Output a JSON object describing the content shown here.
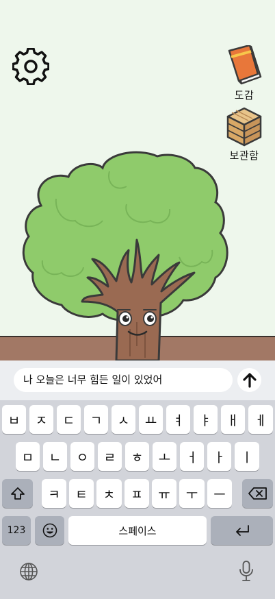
{
  "sidebar": {
    "encyclopedia_label": "도감",
    "storage_label": "보관함"
  },
  "chat": {
    "input_value": "나 오늘은 너무 힘든 일이 있었어"
  },
  "keyboard": {
    "row1": [
      "ㅂ",
      "ㅈ",
      "ㄷ",
      "ㄱ",
      "ㅅ",
      "ㅛ",
      "ㅕ",
      "ㅑ",
      "ㅐ",
      "ㅔ"
    ],
    "row2": [
      "ㅁ",
      "ㄴ",
      "ㅇ",
      "ㄹ",
      "ㅎ",
      "ㅗ",
      "ㅓ",
      "ㅏ",
      "ㅣ"
    ],
    "row3": [
      "ㅋ",
      "ㅌ",
      "ㅊ",
      "ㅍ",
      "ㅠ",
      "ㅜ",
      "ㅡ"
    ],
    "numbers_label": "123",
    "space_label": "스페이스"
  },
  "colors": {
    "canopy": "#8fcb6b",
    "trunk": "#9a6a52",
    "ground": "#a27865",
    "sky": "#eef7ec"
  },
  "icons": [
    "gear-icon",
    "book-icon",
    "crate-icon",
    "arrow-up-icon",
    "shift-icon",
    "delete-icon",
    "emoji-icon",
    "return-icon",
    "globe-icon",
    "microphone-icon"
  ]
}
